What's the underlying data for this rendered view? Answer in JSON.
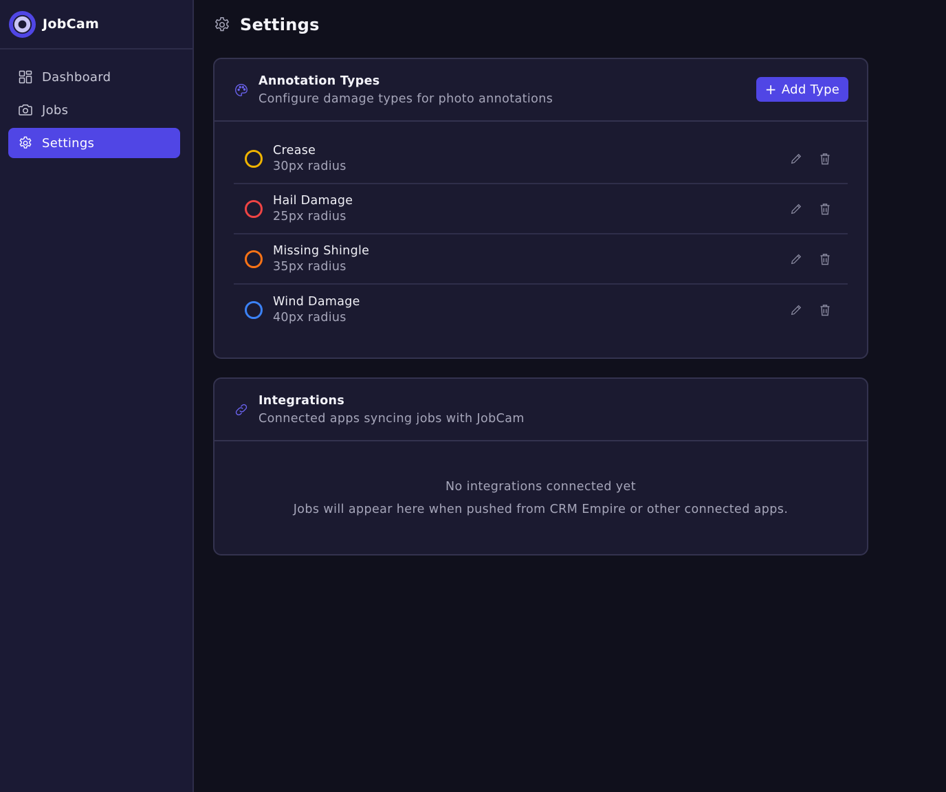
{
  "app": {
    "name": "JobCam",
    "logo_icon": "camera-lens-logo-icon",
    "accent_color": "#5046e5"
  },
  "sidebar": {
    "items": [
      {
        "label": "Dashboard",
        "icon": "grid-icon",
        "active": false
      },
      {
        "label": "Jobs",
        "icon": "camera-icon",
        "active": false
      },
      {
        "label": "Settings",
        "icon": "gear-icon",
        "active": true
      }
    ]
  },
  "page": {
    "title": "Settings",
    "icon": "gear-icon"
  },
  "annotation_types": {
    "title": "Annotation Types",
    "subtitle": "Configure damage types for photo annotations",
    "icon": "palette-icon",
    "add_button_label": "Add Type",
    "items": [
      {
        "name": "Crease",
        "radius": "30px radius",
        "color": "#f0b400"
      },
      {
        "name": "Hail Damage",
        "radius": "25px radius",
        "color": "#ef4444"
      },
      {
        "name": "Missing Shingle",
        "radius": "35px radius",
        "color": "#f97316"
      },
      {
        "name": "Wind Damage",
        "radius": "40px radius",
        "color": "#3b82f6"
      }
    ]
  },
  "integrations": {
    "title": "Integrations",
    "subtitle": "Connected apps syncing jobs with JobCam",
    "icon": "link-icon",
    "empty_title": "No integrations connected yet",
    "empty_message": "Jobs will appear here when pushed from CRM Empire or other connected apps."
  }
}
